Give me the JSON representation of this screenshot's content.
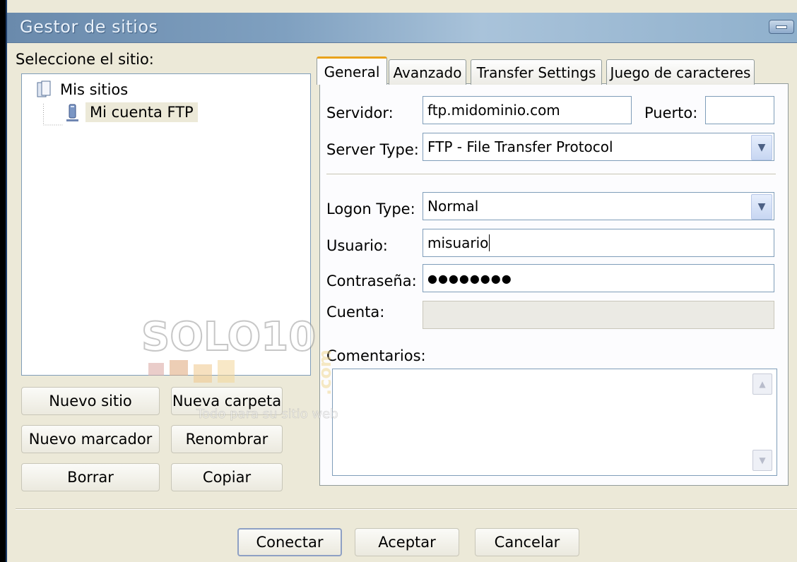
{
  "window": {
    "title": "Gestor de sitios"
  },
  "left": {
    "select_label": "Seleccione el sitio:",
    "tree": {
      "root": "Mis sitios",
      "child": "Mi cuenta FTP"
    },
    "buttons": {
      "new_site": "Nuevo sitio",
      "new_folder": "Nueva carpeta",
      "new_bookmark": "Nuevo marcador",
      "rename": "Renombrar",
      "delete": "Borrar",
      "copy": "Copiar"
    }
  },
  "tabs": [
    "General",
    "Avanzado",
    "Transfer Settings",
    "Juego de caracteres"
  ],
  "general": {
    "server_label": "Servidor:",
    "server_value": "ftp.midominio.com",
    "port_label": "Puerto:",
    "port_value": "",
    "server_type_label": "Server Type:",
    "server_type_value": "FTP - File Transfer Protocol",
    "logon_type_label": "Logon Type:",
    "logon_type_value": "Normal",
    "user_label": "Usuario:",
    "user_value": "misuario",
    "password_label": "Contraseña:",
    "password_value": "●●●●●●●●",
    "account_label": "Cuenta:",
    "account_value": "",
    "comments_label": "Comentarios:"
  },
  "footer": {
    "connect": "Conectar",
    "accept": "Aceptar",
    "cancel": "Cancelar"
  },
  "watermark": {
    "brand": "SOLO10",
    "dotcom": ".com",
    "tagline": "Todo para su sitio web"
  },
  "colors": {
    "title_bar": "#7fa0c0",
    "active_tab_accent": "#e9a21b",
    "dialog_bg": "#ece9d8"
  }
}
